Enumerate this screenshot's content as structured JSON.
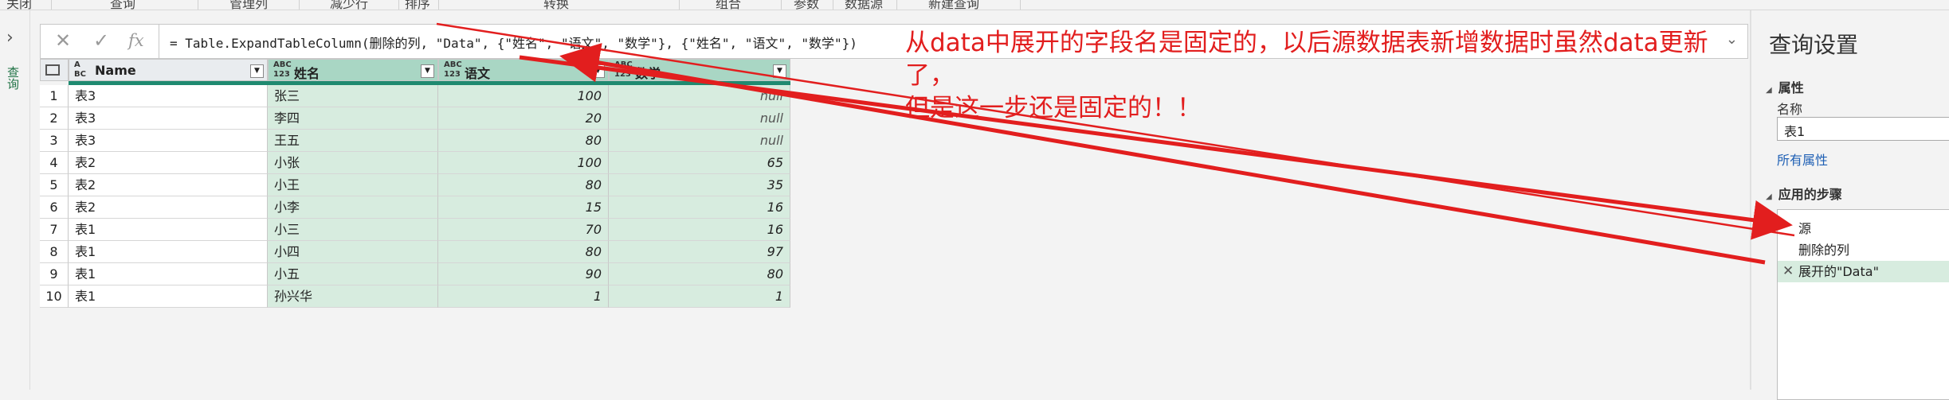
{
  "ribbon": {
    "items": [
      "关闭",
      "查询",
      "管理列",
      "减少行",
      "排序",
      "转换",
      "组合",
      "参数",
      "数据源",
      "新建查询"
    ]
  },
  "nav": {
    "collapse_icon": "chevron-right",
    "queries_label": "查询"
  },
  "formula_bar": {
    "cancel_icon": "close-icon",
    "confirm_icon": "check-icon",
    "fx_label": "fx",
    "formula": "= Table.ExpandTableColumn(删除的列, \"Data\", {\"姓名\", \"语文\", \"数学\"}, {\"姓名\", \"语文\", \"数学\"})",
    "expand_icon": "chevron-down"
  },
  "grid": {
    "columns": [
      {
        "type": "ABC",
        "type_icon_line1": "A",
        "type_icon_line2": "BC",
        "name": "Name"
      },
      {
        "type": "any",
        "type_icon_line1": "ABC",
        "type_icon_line2": "123",
        "name": "姓名"
      },
      {
        "type": "any",
        "type_icon_line1": "ABC",
        "type_icon_line2": "123",
        "name": "语文"
      },
      {
        "type": "any",
        "type_icon_line1": "ABC",
        "type_icon_line2": "123",
        "name": "数学"
      }
    ],
    "rows": [
      {
        "n": "1",
        "name": "表3",
        "xm": "张三",
        "yw": "100",
        "sx": "null"
      },
      {
        "n": "2",
        "name": "表3",
        "xm": "李四",
        "yw": "20",
        "sx": "null"
      },
      {
        "n": "3",
        "name": "表3",
        "xm": "王五",
        "yw": "80",
        "sx": "null"
      },
      {
        "n": "4",
        "name": "表2",
        "xm": "小张",
        "yw": "100",
        "sx": "65"
      },
      {
        "n": "5",
        "name": "表2",
        "xm": "小王",
        "yw": "80",
        "sx": "35"
      },
      {
        "n": "6",
        "name": "表2",
        "xm": "小李",
        "yw": "15",
        "sx": "16"
      },
      {
        "n": "7",
        "name": "表1",
        "xm": "小三",
        "yw": "70",
        "sx": "16"
      },
      {
        "n": "8",
        "name": "表1",
        "xm": "小四",
        "yw": "80",
        "sx": "97"
      },
      {
        "n": "9",
        "name": "表1",
        "xm": "小五",
        "yw": "90",
        "sx": "80"
      },
      {
        "n": "10",
        "name": "表1",
        "xm": "孙兴华",
        "yw": "1",
        "sx": "1"
      }
    ]
  },
  "annotation": {
    "line1": "从data中展开的字段名是固定的，以后源数据表新增数据时虽然data更新了，",
    "line2": "但是这一步还是固定的！！",
    "color": "#e21e1e"
  },
  "settings": {
    "title": "查询设置",
    "properties_header": "属性",
    "name_label": "名称",
    "name_value": "表1",
    "all_properties": "所有属性",
    "steps_header": "应用的步骤",
    "steps": [
      "源",
      "删除的列",
      "展开的\"Data\""
    ]
  },
  "colors": {
    "accent": "#217346",
    "selected": "#d7ecdf",
    "arrow": "#e21e1e"
  }
}
